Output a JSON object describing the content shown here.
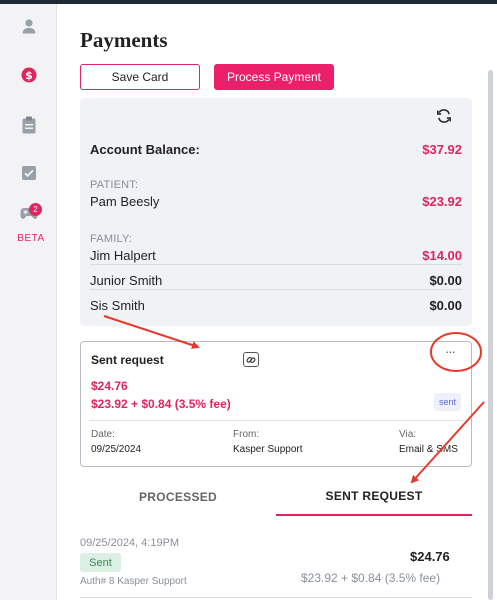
{
  "page": {
    "title": "Payments"
  },
  "sidebar": {
    "items": [
      {
        "icon": "person-icon"
      },
      {
        "icon": "dollar-icon"
      },
      {
        "icon": "clipboard-icon"
      },
      {
        "icon": "checkbox-icon"
      },
      {
        "icon": "gamepad-icon",
        "badge": "2",
        "label": "BETA"
      }
    ]
  },
  "actions": {
    "save_card": "Save Card",
    "process_payment": "Process Payment"
  },
  "balance": {
    "label": "Account Balance:",
    "amount": "$37.92",
    "patient_label": "PATIENT:",
    "patient": {
      "name": "Pam Beesly",
      "amount": "$23.92"
    },
    "family_label": "FAMILY:",
    "family": [
      {
        "name": "Jim Halpert",
        "amount": "$14.00"
      },
      {
        "name": "Junior Smith",
        "amount": "$0.00"
      },
      {
        "name": "Sis Smith",
        "amount": "$0.00"
      }
    ]
  },
  "sent_request": {
    "title": "Sent request",
    "total": "$24.76",
    "breakdown": "$23.92 + $0.84 (3.5% fee)",
    "status": "sent",
    "date_label": "Date:",
    "date": "09/25/2024",
    "from_label": "From:",
    "from": "Kasper Support",
    "via_label": "Via:",
    "via": "Email & SMS"
  },
  "tabs": {
    "processed": "PROCESSED",
    "sent_request": "SENT REQUEST"
  },
  "transaction": {
    "datetime": "09/25/2024, 4:19PM",
    "status": "Sent",
    "auth": "Auth# 8 Kasper Support",
    "amount": "$24.76",
    "breakdown": "$23.92 + $0.84 (3.5% fee)"
  },
  "colors": {
    "accent": "#e0245e",
    "button": "#ec1f6b",
    "panel": "#f0f2f5",
    "annotation": "#e8382b"
  }
}
